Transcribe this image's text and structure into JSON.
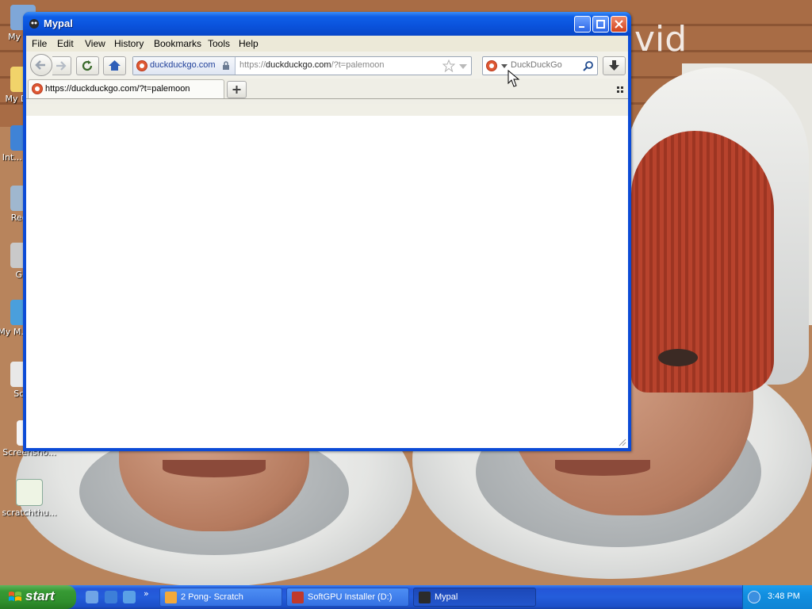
{
  "desktop": {
    "watermark": "vid",
    "icons": [
      {
        "label": "My C..."
      },
      {
        "label": "My Do..."
      },
      {
        "label": "Int... Ex..."
      },
      {
        "label": "Rec..."
      },
      {
        "label": "G..."
      },
      {
        "label": "My M... Pl..."
      },
      {
        "label": "Sc..."
      },
      {
        "label": "Screensho..."
      },
      {
        "label": "scratchthu..."
      }
    ]
  },
  "window": {
    "title": "Mypal",
    "menu": [
      "File",
      "Edit",
      "View",
      "History",
      "Bookmarks",
      "Tools",
      "Help"
    ],
    "identity_domain": "duckduckgo.com",
    "url": {
      "scheme": "https://",
      "host": "duckduckgo.com",
      "path": "/?t=palemoon"
    },
    "search_placeholder": "DuckDuckGo",
    "tabs": [
      {
        "label": "https://duckduckgo.com/?t=palemoon",
        "active": true
      }
    ]
  },
  "taskbar": {
    "start_label": "start",
    "tasks": [
      {
        "label": "2 Pong- Scratch",
        "active": false
      },
      {
        "label": "SoftGPU Installer (D:)",
        "active": false
      },
      {
        "label": "Mypal",
        "active": true
      }
    ],
    "clock": "3:48 PM"
  },
  "colors": {
    "titlebar": "#0a52db",
    "taskbar": "#245ddb",
    "start": "#379a34",
    "ddg": "#de5833"
  }
}
